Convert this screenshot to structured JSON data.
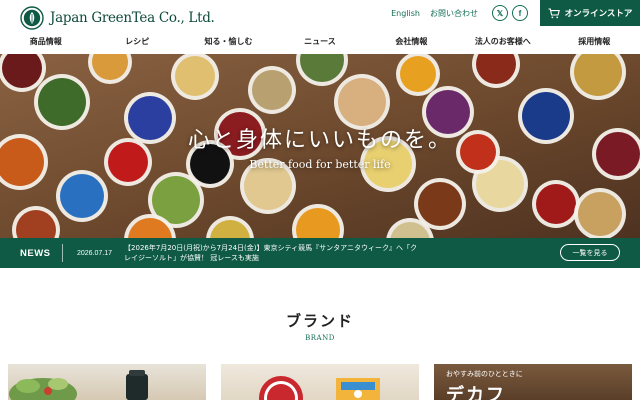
{
  "header": {
    "logo_text": "Japan GreenTea Co., Ltd.",
    "util_links": [
      "English",
      "お問い合わせ"
    ],
    "sns": {
      "x_icon": "x-logo-icon",
      "facebook_icon": "facebook-icon",
      "x_glyph": "𝕏",
      "facebook_glyph": "f"
    },
    "store_button": "オンラインストア",
    "colors": {
      "brand_green": "#0e5a44",
      "text_green": "#136e54"
    }
  },
  "nav": {
    "items": [
      "商品情報",
      "レシピ",
      "知る・愉しむ",
      "ニュース",
      "会社情報",
      "法人のお客様へ",
      "採用情報"
    ]
  },
  "hero": {
    "title": "心と身体にいいものを。",
    "subtitle": "Better food for better life"
  },
  "news": {
    "label": "NEWS",
    "date": "2026.07.17",
    "text": "【2026年7月20日(月祝)から7月24日(金)】東京シティ競馬『サンタアニタウィーク』へ「クレイジーソルト」が協賛！ 冠レースも実施",
    "more_button": "一覧を見る"
  },
  "brand": {
    "title": "ブランド",
    "subtitle": "BRAND",
    "cards": [
      {
        "copy": ""
      },
      {
        "copy": ""
      },
      {
        "copy": "おやすみ前のひとときに",
        "big": "デカフ"
      }
    ]
  }
}
